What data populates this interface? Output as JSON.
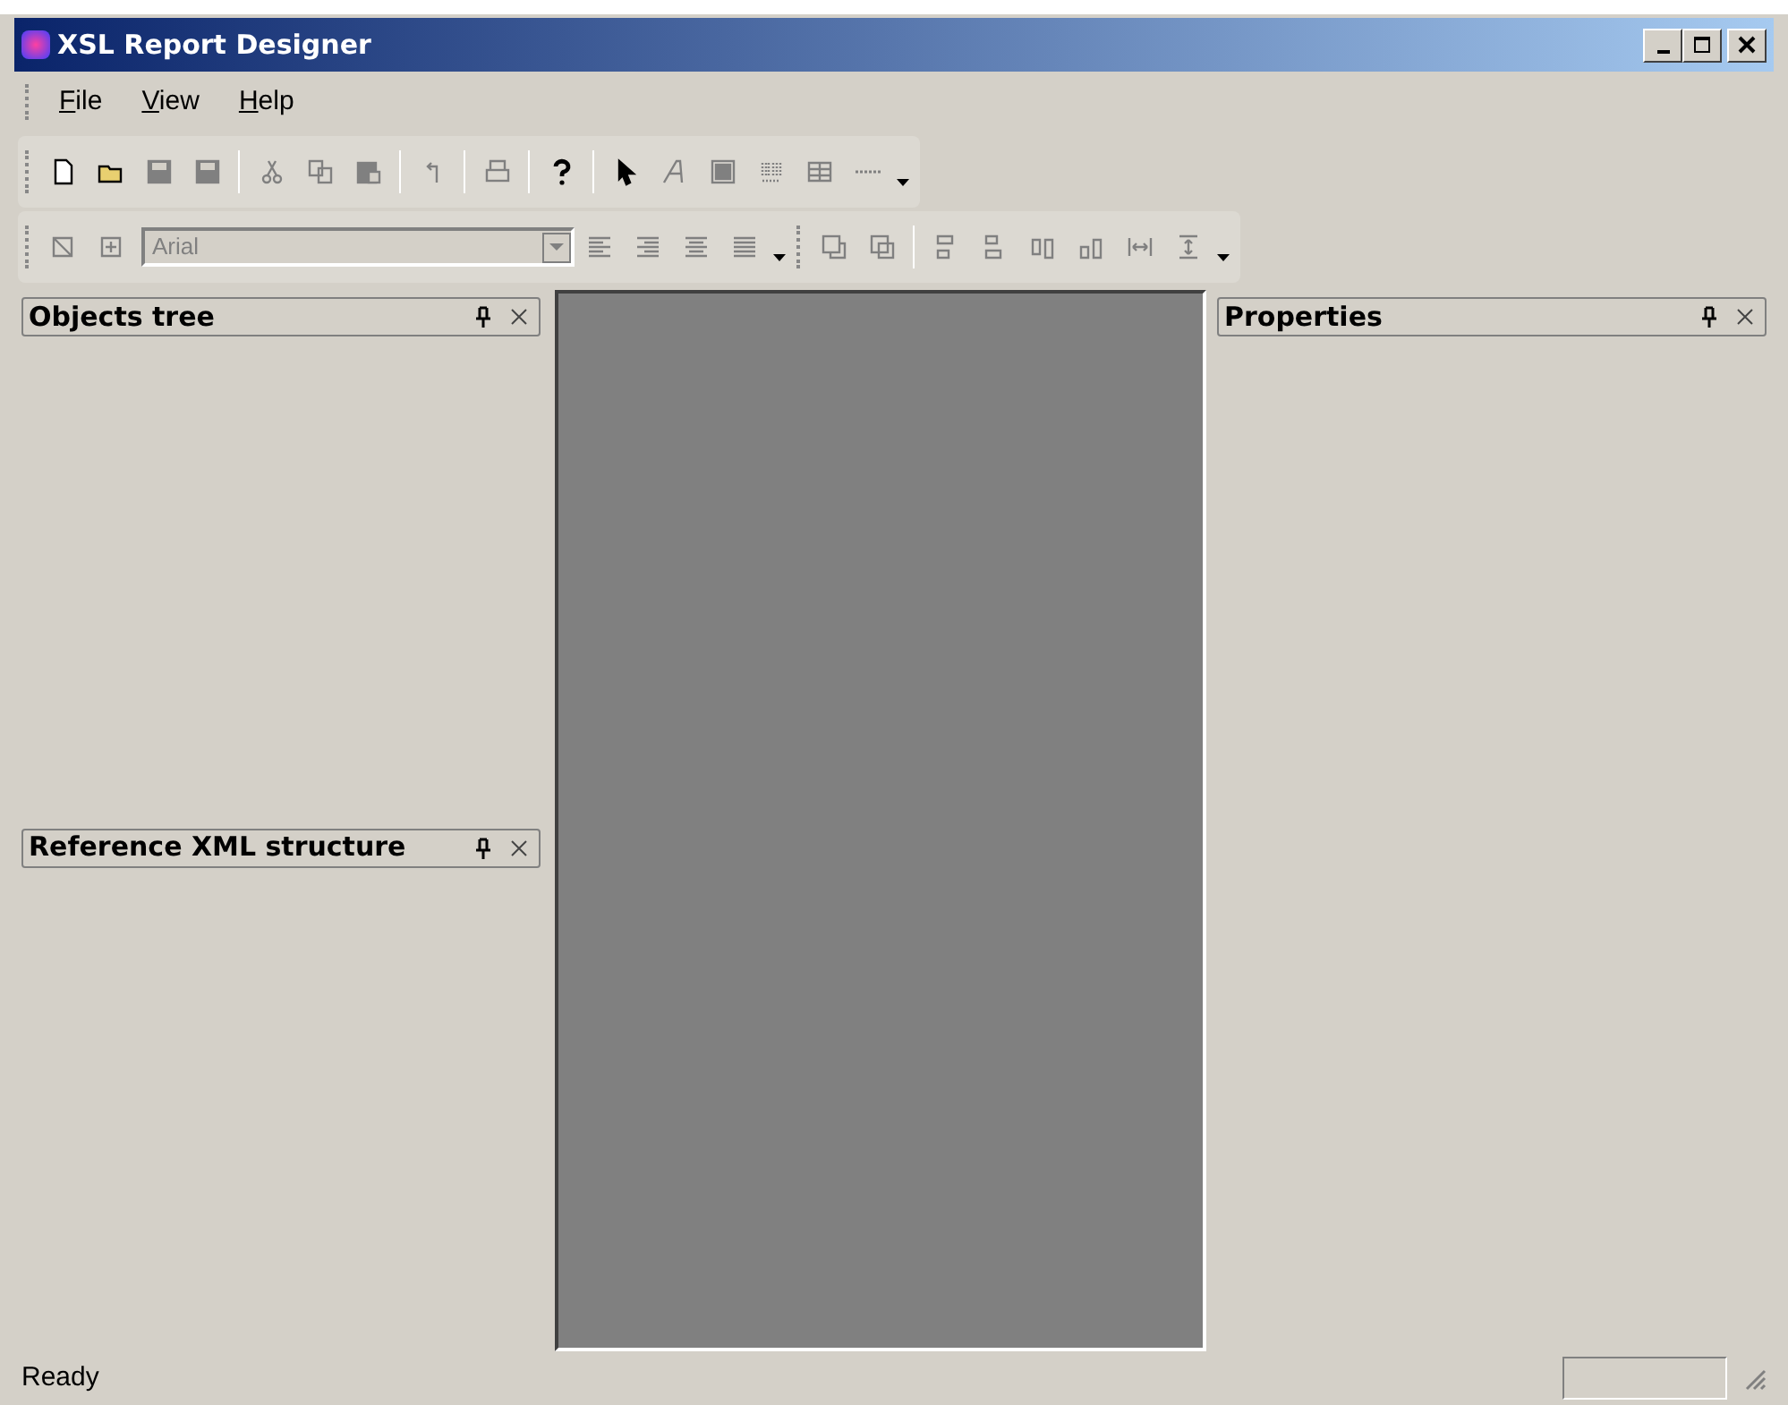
{
  "window": {
    "title": "XSL Report Designer"
  },
  "menu": [
    {
      "label": "File"
    },
    {
      "label": "View"
    },
    {
      "label": "Help"
    }
  ],
  "toolbars": [
    [
      {
        "kind": "new",
        "disabled": false
      },
      {
        "kind": "open",
        "disabled": false
      },
      {
        "kind": "save",
        "disabled": true
      },
      {
        "kind": "save-all",
        "disabled": true
      },
      {
        "kind": "sep"
      },
      {
        "kind": "cut",
        "disabled": true
      },
      {
        "kind": "copy",
        "disabled": true
      },
      {
        "kind": "paste",
        "disabled": true
      },
      {
        "kind": "sep"
      },
      {
        "kind": "undo",
        "disabled": true
      },
      {
        "kind": "sep"
      },
      {
        "kind": "print",
        "disabled": true
      },
      {
        "kind": "sep"
      },
      {
        "kind": "help",
        "disabled": false
      },
      {
        "kind": "sep"
      },
      {
        "kind": "pointer",
        "disabled": false
      },
      {
        "kind": "text",
        "disabled": true
      },
      {
        "kind": "rect",
        "disabled": true
      },
      {
        "kind": "barcode",
        "disabled": true
      },
      {
        "kind": "table",
        "disabled": true
      },
      {
        "kind": "line",
        "disabled": true
      },
      {
        "kind": "more"
      }
    ],
    [
      {
        "kind": "box",
        "disabled": true
      },
      {
        "kind": "plus",
        "disabled": true
      },
      {
        "kind": "font",
        "value": "Arial",
        "disabled": true
      },
      {
        "kind": "align-left",
        "disabled": true
      },
      {
        "kind": "align-right",
        "disabled": true
      },
      {
        "kind": "align-center",
        "disabled": true
      },
      {
        "kind": "justify",
        "disabled": true
      },
      {
        "kind": "more"
      },
      {
        "kind": "grip"
      },
      {
        "kind": "front",
        "disabled": true
      },
      {
        "kind": "back",
        "disabled": true
      },
      {
        "kind": "sep"
      },
      {
        "kind": "align-top",
        "disabled": true
      },
      {
        "kind": "align-bottom",
        "disabled": true
      },
      {
        "kind": "align-l",
        "disabled": true
      },
      {
        "kind": "align-r",
        "disabled": true
      },
      {
        "kind": "space-h",
        "disabled": true
      },
      {
        "kind": "space-v",
        "disabled": true
      },
      {
        "kind": "more"
      }
    ]
  ],
  "left_panels": [
    {
      "title": "Objects tree"
    },
    {
      "title": "Reference XML structure"
    }
  ],
  "right_panel": {
    "title": "Properties"
  },
  "status_bar": {
    "text": "Ready"
  }
}
